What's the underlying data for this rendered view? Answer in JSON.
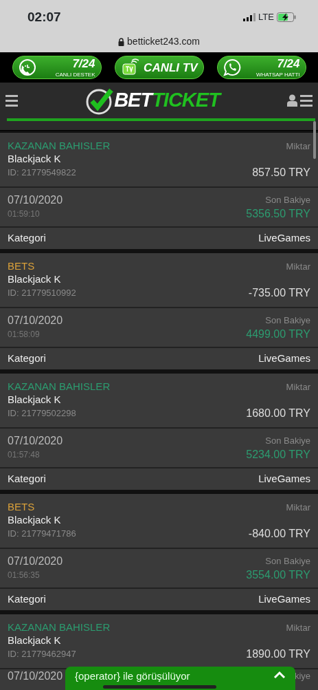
{
  "status_bar": {
    "time": "02:07",
    "network": "LTE"
  },
  "browser": {
    "url": "betticket243.com"
  },
  "promo_buttons": [
    {
      "kind": "support",
      "big": "7/24",
      "small": "CANLI DESTEK"
    },
    {
      "kind": "tv",
      "big": "CANLI TV"
    },
    {
      "kind": "whatsapp",
      "big": "7/24",
      "small": "WHATSAP HATTI"
    }
  ],
  "logo": {
    "part_1": "BET",
    "part_2": "TICKET"
  },
  "transactions": [
    {
      "kind": "win",
      "type": "KAZANAN BAHISLER",
      "amount_label": "Miktar",
      "game": "Blackjack K",
      "id": "ID: 21779549822",
      "amount": "857.50 TRY",
      "date": "07/10/2020",
      "balance_label": "Son Bakiye",
      "time": "01:59:10",
      "balance": "5356.50 TRY",
      "category_label": "Kategori",
      "category": "LiveGames"
    },
    {
      "kind": "bet",
      "type": "BETS",
      "amount_label": "Miktar",
      "game": "Blackjack K",
      "id": "ID: 21779510992",
      "amount": "-735.00 TRY",
      "date": "07/10/2020",
      "balance_label": "Son Bakiye",
      "time": "01:58:09",
      "balance": "4499.00 TRY",
      "category_label": "Kategori",
      "category": "LiveGames"
    },
    {
      "kind": "win",
      "type": "KAZANAN BAHISLER",
      "amount_label": "Miktar",
      "game": "Blackjack K",
      "id": "ID: 21779502298",
      "amount": "1680.00 TRY",
      "date": "07/10/2020",
      "balance_label": "Son Bakiye",
      "time": "01:57:48",
      "balance": "5234.00 TRY",
      "category_label": "Kategori",
      "category": "LiveGames"
    },
    {
      "kind": "bet",
      "type": "BETS",
      "amount_label": "Miktar",
      "game": "Blackjack K",
      "id": "ID: 21779471786",
      "amount": "-840.00 TRY",
      "date": "07/10/2020",
      "balance_label": "Son Bakiye",
      "time": "01:56:35",
      "balance": "3554.00 TRY",
      "category_label": "Kategori",
      "category": "LiveGames"
    },
    {
      "kind": "win",
      "type": "KAZANAN BAHISLER",
      "amount_label": "Miktar",
      "game": "Blackjack K",
      "id": "ID: 21779462947",
      "amount": "1890.00 TRY",
      "date": "07/10/2020",
      "balance_label": "kiye"
    }
  ],
  "chat": {
    "text": "{operator} ile görüşülüyor"
  }
}
